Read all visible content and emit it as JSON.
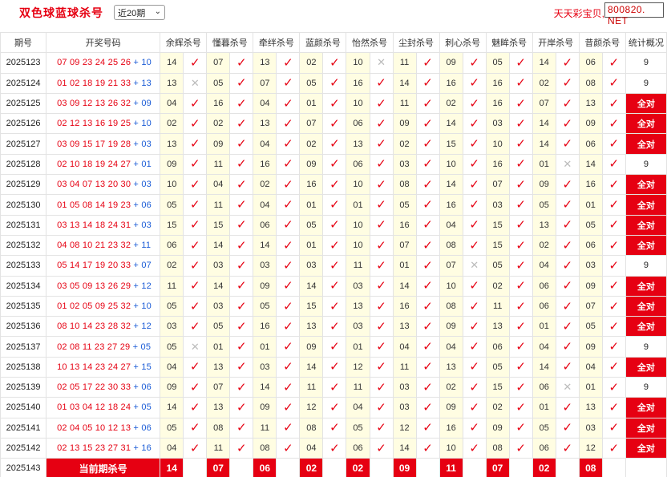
{
  "header": {
    "title": "双色球蓝球杀号",
    "period_selected": "近20期",
    "brand_text": "天天彩宝贝,",
    "brand_site": "800820. NET"
  },
  "columns": [
    "期号",
    "开奖号码",
    "余辉杀号",
    "懂暮杀号",
    "牵绊杀号",
    "蓝颜杀号",
    "怡然杀号",
    "尘封杀号",
    "刺心杀号",
    "魅眸杀号",
    "开岸杀号",
    "昔颜杀号",
    "统计概况"
  ],
  "rows": [
    {
      "issue": "2025123",
      "red": "07 09 23 24 25 26",
      "blue": "10",
      "kills": [
        [
          "14",
          1
        ],
        [
          "07",
          1
        ],
        [
          "13",
          1
        ],
        [
          "02",
          1
        ],
        [
          "10",
          0
        ],
        [
          "11",
          1
        ],
        [
          "09",
          1
        ],
        [
          "05",
          1
        ],
        [
          "14",
          1
        ],
        [
          "06",
          1
        ]
      ],
      "stat": "9"
    },
    {
      "issue": "2025124",
      "red": "01 02 18 19 21 33",
      "blue": "13",
      "kills": [
        [
          "13",
          0
        ],
        [
          "05",
          1
        ],
        [
          "07",
          1
        ],
        [
          "05",
          1
        ],
        [
          "16",
          1
        ],
        [
          "14",
          1
        ],
        [
          "16",
          1
        ],
        [
          "16",
          1
        ],
        [
          "02",
          1
        ],
        [
          "08",
          1
        ]
      ],
      "stat": "9"
    },
    {
      "issue": "2025125",
      "red": "03 09 12 13 26 32",
      "blue": "09",
      "kills": [
        [
          "04",
          1
        ],
        [
          "16",
          1
        ],
        [
          "04",
          1
        ],
        [
          "01",
          1
        ],
        [
          "10",
          1
        ],
        [
          "11",
          1
        ],
        [
          "02",
          1
        ],
        [
          "16",
          1
        ],
        [
          "07",
          1
        ],
        [
          "13",
          1
        ]
      ],
      "stat": "全对"
    },
    {
      "issue": "2025126",
      "red": "02 12 13 16 19 25",
      "blue": "10",
      "kills": [
        [
          "02",
          1
        ],
        [
          "02",
          1
        ],
        [
          "13",
          1
        ],
        [
          "07",
          1
        ],
        [
          "06",
          1
        ],
        [
          "09",
          1
        ],
        [
          "14",
          1
        ],
        [
          "03",
          1
        ],
        [
          "14",
          1
        ],
        [
          "09",
          1
        ]
      ],
      "stat": "全对"
    },
    {
      "issue": "2025127",
      "red": "03 09 15 17 19 28",
      "blue": "03",
      "kills": [
        [
          "13",
          1
        ],
        [
          "09",
          1
        ],
        [
          "04",
          1
        ],
        [
          "02",
          1
        ],
        [
          "13",
          1
        ],
        [
          "02",
          1
        ],
        [
          "15",
          1
        ],
        [
          "10",
          1
        ],
        [
          "14",
          1
        ],
        [
          "06",
          1
        ]
      ],
      "stat": "全对"
    },
    {
      "issue": "2025128",
      "red": "02 10 18 19 24 27",
      "blue": "01",
      "kills": [
        [
          "09",
          1
        ],
        [
          "11",
          1
        ],
        [
          "16",
          1
        ],
        [
          "09",
          1
        ],
        [
          "06",
          1
        ],
        [
          "03",
          1
        ],
        [
          "10",
          1
        ],
        [
          "16",
          1
        ],
        [
          "01",
          0
        ],
        [
          "14",
          1
        ]
      ],
      "stat": "9"
    },
    {
      "issue": "2025129",
      "red": "03 04 07 13 20 30",
      "blue": "03",
      "kills": [
        [
          "10",
          1
        ],
        [
          "04",
          1
        ],
        [
          "02",
          1
        ],
        [
          "16",
          1
        ],
        [
          "10",
          1
        ],
        [
          "08",
          1
        ],
        [
          "14",
          1
        ],
        [
          "07",
          1
        ],
        [
          "09",
          1
        ],
        [
          "16",
          1
        ]
      ],
      "stat": "全对"
    },
    {
      "issue": "2025130",
      "red": "01 05 08 14 19 23",
      "blue": "06",
      "kills": [
        [
          "05",
          1
        ],
        [
          "11",
          1
        ],
        [
          "04",
          1
        ],
        [
          "01",
          1
        ],
        [
          "01",
          1
        ],
        [
          "05",
          1
        ],
        [
          "16",
          1
        ],
        [
          "03",
          1
        ],
        [
          "05",
          1
        ],
        [
          "01",
          1
        ]
      ],
      "stat": "全对"
    },
    {
      "issue": "2025131",
      "red": "03 13 14 18 24 31",
      "blue": "03",
      "kills": [
        [
          "15",
          1
        ],
        [
          "15",
          1
        ],
        [
          "06",
          1
        ],
        [
          "05",
          1
        ],
        [
          "10",
          1
        ],
        [
          "16",
          1
        ],
        [
          "04",
          1
        ],
        [
          "15",
          1
        ],
        [
          "13",
          1
        ],
        [
          "05",
          1
        ]
      ],
      "stat": "全对"
    },
    {
      "issue": "2025132",
      "red": "04 08 10 21 23 32",
      "blue": "11",
      "kills": [
        [
          "06",
          1
        ],
        [
          "14",
          1
        ],
        [
          "14",
          1
        ],
        [
          "01",
          1
        ],
        [
          "10",
          1
        ],
        [
          "07",
          1
        ],
        [
          "08",
          1
        ],
        [
          "15",
          1
        ],
        [
          "02",
          1
        ],
        [
          "06",
          1
        ]
      ],
      "stat": "全对"
    },
    {
      "issue": "2025133",
      "red": "05 14 17 19 20 33",
      "blue": "07",
      "kills": [
        [
          "02",
          1
        ],
        [
          "03",
          1
        ],
        [
          "03",
          1
        ],
        [
          "03",
          1
        ],
        [
          "11",
          1
        ],
        [
          "01",
          1
        ],
        [
          "07",
          0
        ],
        [
          "05",
          1
        ],
        [
          "04",
          1
        ],
        [
          "03",
          1
        ]
      ],
      "stat": "9"
    },
    {
      "issue": "2025134",
      "red": "03 05 09 13 26 29",
      "blue": "12",
      "kills": [
        [
          "11",
          1
        ],
        [
          "14",
          1
        ],
        [
          "09",
          1
        ],
        [
          "14",
          1
        ],
        [
          "03",
          1
        ],
        [
          "14",
          1
        ],
        [
          "10",
          1
        ],
        [
          "02",
          1
        ],
        [
          "06",
          1
        ],
        [
          "09",
          1
        ]
      ],
      "stat": "全对"
    },
    {
      "issue": "2025135",
      "red": "01 02 05 09 25 32",
      "blue": "10",
      "kills": [
        [
          "05",
          1
        ],
        [
          "03",
          1
        ],
        [
          "05",
          1
        ],
        [
          "15",
          1
        ],
        [
          "13",
          1
        ],
        [
          "16",
          1
        ],
        [
          "08",
          1
        ],
        [
          "11",
          1
        ],
        [
          "06",
          1
        ],
        [
          "07",
          1
        ]
      ],
      "stat": "全对"
    },
    {
      "issue": "2025136",
      "red": "08 10 14 23 28 32",
      "blue": "12",
      "kills": [
        [
          "03",
          1
        ],
        [
          "05",
          1
        ],
        [
          "16",
          1
        ],
        [
          "13",
          1
        ],
        [
          "03",
          1
        ],
        [
          "13",
          1
        ],
        [
          "09",
          1
        ],
        [
          "13",
          1
        ],
        [
          "01",
          1
        ],
        [
          "05",
          1
        ]
      ],
      "stat": "全对"
    },
    {
      "issue": "2025137",
      "red": "02 08 11 23 27 29",
      "blue": "05",
      "kills": [
        [
          "05",
          0
        ],
        [
          "01",
          1
        ],
        [
          "01",
          1
        ],
        [
          "09",
          1
        ],
        [
          "01",
          1
        ],
        [
          "04",
          1
        ],
        [
          "04",
          1
        ],
        [
          "06",
          1
        ],
        [
          "04",
          1
        ],
        [
          "09",
          1
        ]
      ],
      "stat": "9"
    },
    {
      "issue": "2025138",
      "red": "10 13 14 23 24 27",
      "blue": "15",
      "kills": [
        [
          "04",
          1
        ],
        [
          "13",
          1
        ],
        [
          "03",
          1
        ],
        [
          "14",
          1
        ],
        [
          "12",
          1
        ],
        [
          "11",
          1
        ],
        [
          "13",
          1
        ],
        [
          "05",
          1
        ],
        [
          "14",
          1
        ],
        [
          "04",
          1
        ]
      ],
      "stat": "全对"
    },
    {
      "issue": "2025139",
      "red": "02 05 17 22 30 33",
      "blue": "06",
      "kills": [
        [
          "09",
          1
        ],
        [
          "07",
          1
        ],
        [
          "14",
          1
        ],
        [
          "11",
          1
        ],
        [
          "11",
          1
        ],
        [
          "03",
          1
        ],
        [
          "02",
          1
        ],
        [
          "15",
          1
        ],
        [
          "06",
          0
        ],
        [
          "01",
          1
        ]
      ],
      "stat": "9"
    },
    {
      "issue": "2025140",
      "red": "01 03 04 12 18 24",
      "blue": "05",
      "kills": [
        [
          "14",
          1
        ],
        [
          "13",
          1
        ],
        [
          "09",
          1
        ],
        [
          "12",
          1
        ],
        [
          "04",
          1
        ],
        [
          "03",
          1
        ],
        [
          "09",
          1
        ],
        [
          "02",
          1
        ],
        [
          "01",
          1
        ],
        [
          "13",
          1
        ]
      ],
      "stat": "全对"
    },
    {
      "issue": "2025141",
      "red": "02 04 05 10 12 13",
      "blue": "06",
      "kills": [
        [
          "05",
          1
        ],
        [
          "08",
          1
        ],
        [
          "11",
          1
        ],
        [
          "08",
          1
        ],
        [
          "05",
          1
        ],
        [
          "12",
          1
        ],
        [
          "16",
          1
        ],
        [
          "09",
          1
        ],
        [
          "05",
          1
        ],
        [
          "03",
          1
        ]
      ],
      "stat": "全对"
    },
    {
      "issue": "2025142",
      "red": "02 13 15 23 27 31",
      "blue": "16",
      "kills": [
        [
          "04",
          1
        ],
        [
          "11",
          1
        ],
        [
          "08",
          1
        ],
        [
          "04",
          1
        ],
        [
          "06",
          1
        ],
        [
          "14",
          1
        ],
        [
          "10",
          1
        ],
        [
          "08",
          1
        ],
        [
          "06",
          1
        ],
        [
          "12",
          1
        ]
      ],
      "stat": "全对"
    }
  ],
  "current": {
    "issue": "2025143",
    "label": "当前期杀号",
    "kills": [
      "14",
      "07",
      "06",
      "02",
      "02",
      "09",
      "11",
      "07",
      "02",
      "08"
    ]
  },
  "symbols": {
    "check": "✓",
    "cross": "✕",
    "plus": "+",
    "arrow": "⌄"
  },
  "colors": {
    "accent_red": "#e60012",
    "blue_ball": "#1a5bd6",
    "kill_cell_bg": "#fffde2"
  }
}
